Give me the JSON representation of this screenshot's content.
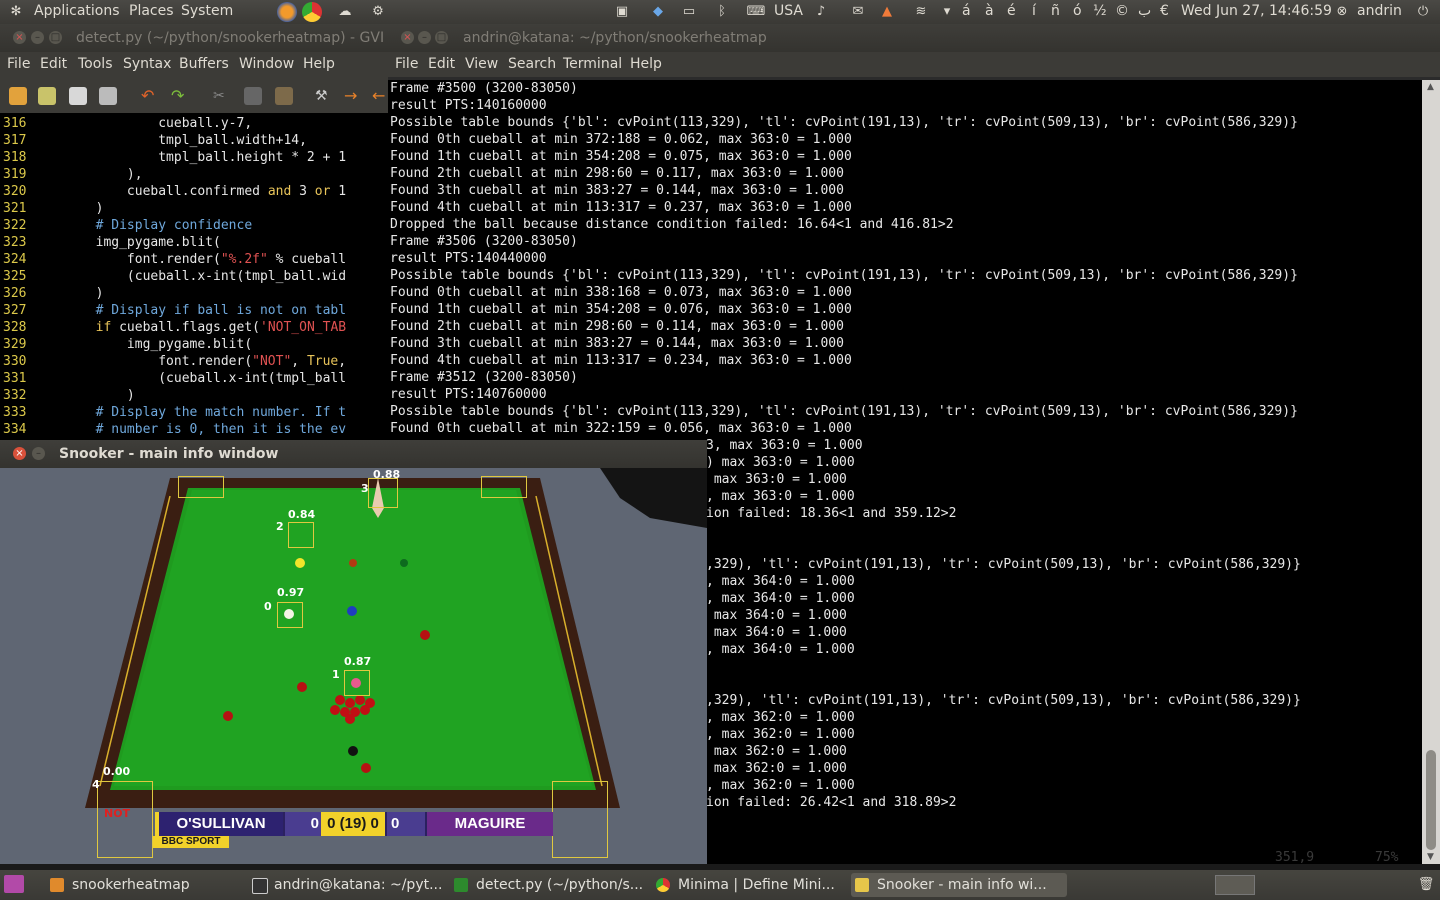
{
  "top_panel": {
    "menus": [
      "Applications",
      "Places",
      "System"
    ],
    "keyboard_layout": "USA",
    "accent_chars": [
      "á",
      "à",
      "é",
      "í",
      "ñ",
      "ó",
      "½",
      "©",
      "ب",
      "€"
    ],
    "clock": "Wed Jun 27, 14:46:59",
    "user": "andrin"
  },
  "gvim": {
    "title": "detect.py (~/python/snookerheatmap) - GVI",
    "menu": [
      "File",
      "Edit",
      "Tools",
      "Syntax",
      "Buffers",
      "Window",
      "Help"
    ],
    "lines": [
      {
        "n": "316",
        "code": "                cueball.y-7,"
      },
      {
        "n": "317",
        "code": "                tmpl_ball.width+14,"
      },
      {
        "n": "318",
        "code": "                tmpl_ball.height * 2 + 1"
      },
      {
        "n": "319",
        "code": "            ),"
      },
      {
        "n": "320",
        "code": "            cueball.confirmed and 3 or 1"
      },
      {
        "n": "321",
        "code": "        )"
      },
      {
        "n": "322",
        "code": "        # Display confidence"
      },
      {
        "n": "323",
        "code": "        img_pygame.blit("
      },
      {
        "n": "324",
        "code": "            font.render(\"%.2f\" % cueball"
      },
      {
        "n": "325",
        "code": "            (cueball.x-int(tmpl_ball.wid"
      },
      {
        "n": "326",
        "code": "        )"
      },
      {
        "n": "327",
        "code": "        # Display if ball is not on tabl"
      },
      {
        "n": "328",
        "code": "        if cueball.flags.get('NOT_ON_TAB"
      },
      {
        "n": "329",
        "code": "            img_pygame.blit("
      },
      {
        "n": "330",
        "code": "                font.render(\"NOT\", True,"
      },
      {
        "n": "331",
        "code": "                (cueball.x-int(tmpl_ball"
      },
      {
        "n": "332",
        "code": "            )"
      },
      {
        "n": "333",
        "code": "        # Display the match number. If t"
      },
      {
        "n": "334",
        "code": "        # number is 0, then it is the ev"
      }
    ]
  },
  "terminal": {
    "title": "andrin@katana: ~/python/snookerheatmap",
    "menu": [
      "File",
      "Edit",
      "View",
      "Search",
      "Terminal",
      "Help"
    ],
    "lines_full": [
      "Frame #3500 (3200-83050)",
      "result PTS:140160000",
      "Possible table bounds {'bl': cvPoint(113,329), 'tl': cvPoint(191,13), 'tr': cvPoint(509,13), 'br': cvPoint(586,329)}",
      "Found 0th cueball at min 372:188 = 0.062, max 363:0 = 1.000",
      "Found 1th cueball at min 354:208 = 0.075, max 363:0 = 1.000",
      "Found 2th cueball at min 298:60 = 0.117, max 363:0 = 1.000",
      "Found 3th cueball at min 383:27 = 0.144, max 363:0 = 1.000",
      "Found 4th cueball at min 113:317 = 0.237, max 363:0 = 1.000",
      "Dropped the ball because distance condition failed: 16.64<1 and 416.81>2",
      "Frame #3506 (3200-83050)",
      "result PTS:140440000",
      "Possible table bounds {'bl': cvPoint(113,329), 'tl': cvPoint(191,13), 'tr': cvPoint(509,13), 'br': cvPoint(586,329)}",
      "Found 0th cueball at min 338:168 = 0.073, max 363:0 = 1.000",
      "Found 1th cueball at min 354:208 = 0.076, max 363:0 = 1.000",
      "Found 2th cueball at min 298:60 = 0.114, max 363:0 = 1.000",
      "Found 3th cueball at min 383:27 = 0.144, max 363:0 = 1.000",
      "Found 4th cueball at min 113:317 = 0.234, max 363:0 = 1.000",
      "Frame #3512 (3200-83050)",
      "result PTS:140760000",
      "Possible table bounds {'bl': cvPoint(113,329), 'tl': cvPoint(191,13), 'tr': cvPoint(509,13), 'br': cvPoint(586,329)}",
      "Found 0th cueball at min 322:159 = 0.056, max 363:0 = 1.000"
    ],
    "lines_partial": [
      "3, max 363:0 = 1.000",
      ") max 363:0 = 1.000",
      " max 363:0 = 1.000",
      ", max 363:0 = 1.000",
      "ion failed: 18.36<1 and 359.12>2",
      "",
      "",
      ",329), 'tl': cvPoint(191,13), 'tr': cvPoint(509,13), 'br': cvPoint(586,329)}",
      ", max 364:0 = 1.000",
      ", max 364:0 = 1.000",
      " max 364:0 = 1.000",
      " max 364:0 = 1.000",
      ", max 364:0 = 1.000",
      "",
      "",
      ",329), 'tl': cvPoint(191,13), 'tr': cvPoint(509,13), 'br': cvPoint(586,329)}",
      ", max 362:0 = 1.000",
      ", max 362:0 = 1.000",
      " max 362:0 = 1.000",
      " max 362:0 = 1.000",
      ", max 362:0 = 1.000",
      "ion failed: 26.42<1 and 318.89>2"
    ],
    "ghost_position": "351,9",
    "ghost_percent": "75%"
  },
  "snooker": {
    "title": "Snooker - main info window",
    "confidences": [
      "0.88",
      "0.84",
      "0.97",
      "0.87",
      "0.00"
    ],
    "ball_ids": [
      "3",
      "2",
      "0",
      "1",
      "4"
    ],
    "not_label": "NOT",
    "scoreboard": {
      "player_left": "O'SULLIVAN",
      "score_left": "0",
      "frames": "0 (19) 0",
      "score_right": "0",
      "player_right": "MAGUIRE",
      "broadcaster": "BBC SPORT"
    }
  },
  "taskbar": {
    "items": [
      "snookerheatmap",
      "andrin@katana: ~/pyt...",
      "detect.py (~/python/s...",
      "Minima | Define Mini...",
      "Snooker - main info wi..."
    ]
  }
}
